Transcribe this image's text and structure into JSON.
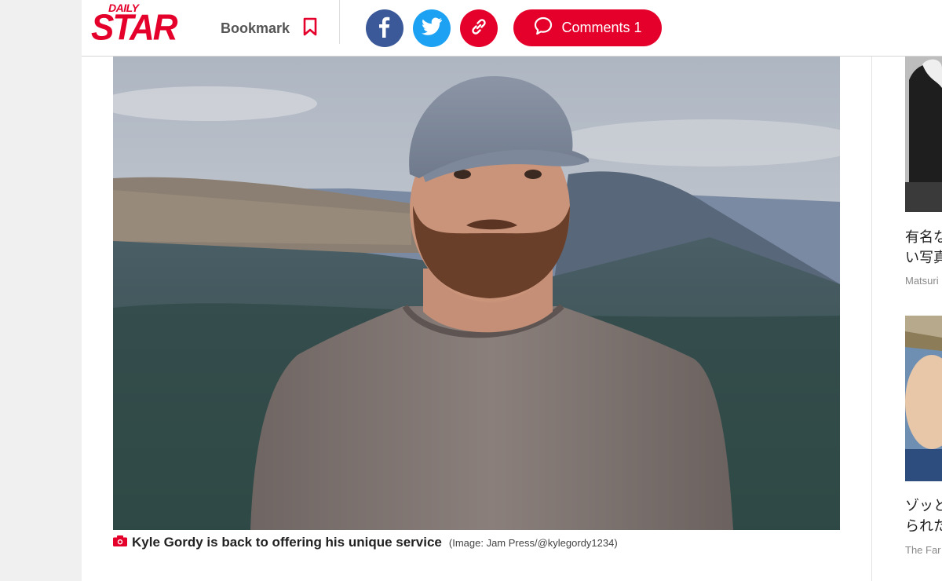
{
  "header": {
    "logo_top": "DAILY",
    "logo_main": "STAR",
    "bookmark_label": "Bookmark",
    "comments_label": "Comments",
    "comments_count": "1"
  },
  "article": {
    "caption": "Kyle Gordy is back to offering his unique service",
    "credit": "(Image: Jam Press/@kylegordy1234)"
  },
  "rail": {
    "items": [
      {
        "title_line1": "有名な",
        "title_line2": "い写真",
        "source": "Matsuri"
      },
      {
        "title_line1": "ゾッと",
        "title_line2": "られた",
        "source": "The Far"
      }
    ]
  },
  "colors": {
    "brand": "#e4002b",
    "facebook": "#3b5998",
    "twitter": "#1da1f2"
  },
  "icons": [
    "bookmark-icon",
    "facebook-icon",
    "twitter-icon",
    "link-icon",
    "comment-icon",
    "camera-icon"
  ]
}
